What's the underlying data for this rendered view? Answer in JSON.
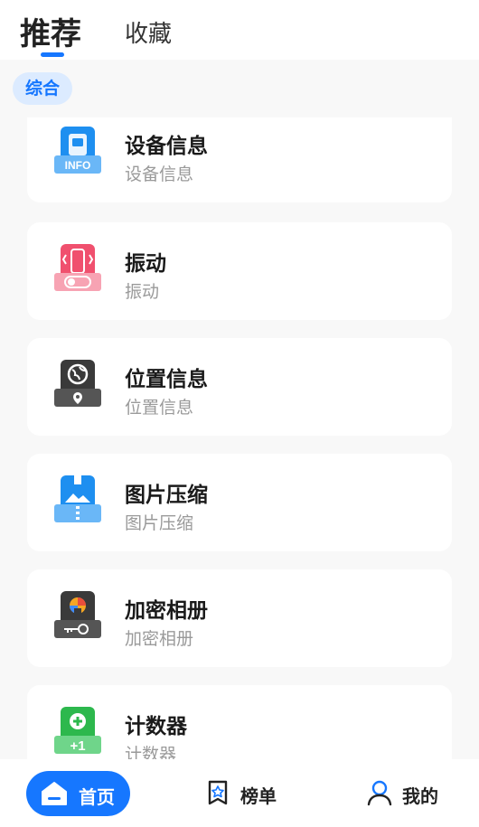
{
  "tabs": {
    "active": "推荐",
    "favorites": "收藏"
  },
  "category": {
    "selected": "综合"
  },
  "tools": [
    {
      "title": "设备信息",
      "subtitle": "设备信息",
      "icon": "info-device-icon",
      "color": "#1e8ff0"
    },
    {
      "title": "振动",
      "subtitle": "振动",
      "icon": "vibration-icon",
      "color": "#f0506e"
    },
    {
      "title": "位置信息",
      "subtitle": "位置信息",
      "icon": "location-globe-icon",
      "color": "#3a3a3a"
    },
    {
      "title": "图片压缩",
      "subtitle": "图片压缩",
      "icon": "image-compress-icon",
      "color": "#1e8ff0"
    },
    {
      "title": "加密相册",
      "subtitle": "加密相册",
      "icon": "encrypted-album-icon",
      "color": "#3a3a3a"
    },
    {
      "title": "计数器",
      "subtitle": "计数器",
      "icon": "counter-icon",
      "color": "#2db84d"
    }
  ],
  "icon_labels": {
    "info": "INFO",
    "plus_one": "+1"
  },
  "bottom_nav": {
    "home": "首页",
    "rank": "榜单",
    "mine": "我的"
  },
  "colors": {
    "accent": "#1677ff",
    "chip_bg": "#dcebff",
    "page_bg": "#f8f8f8"
  }
}
